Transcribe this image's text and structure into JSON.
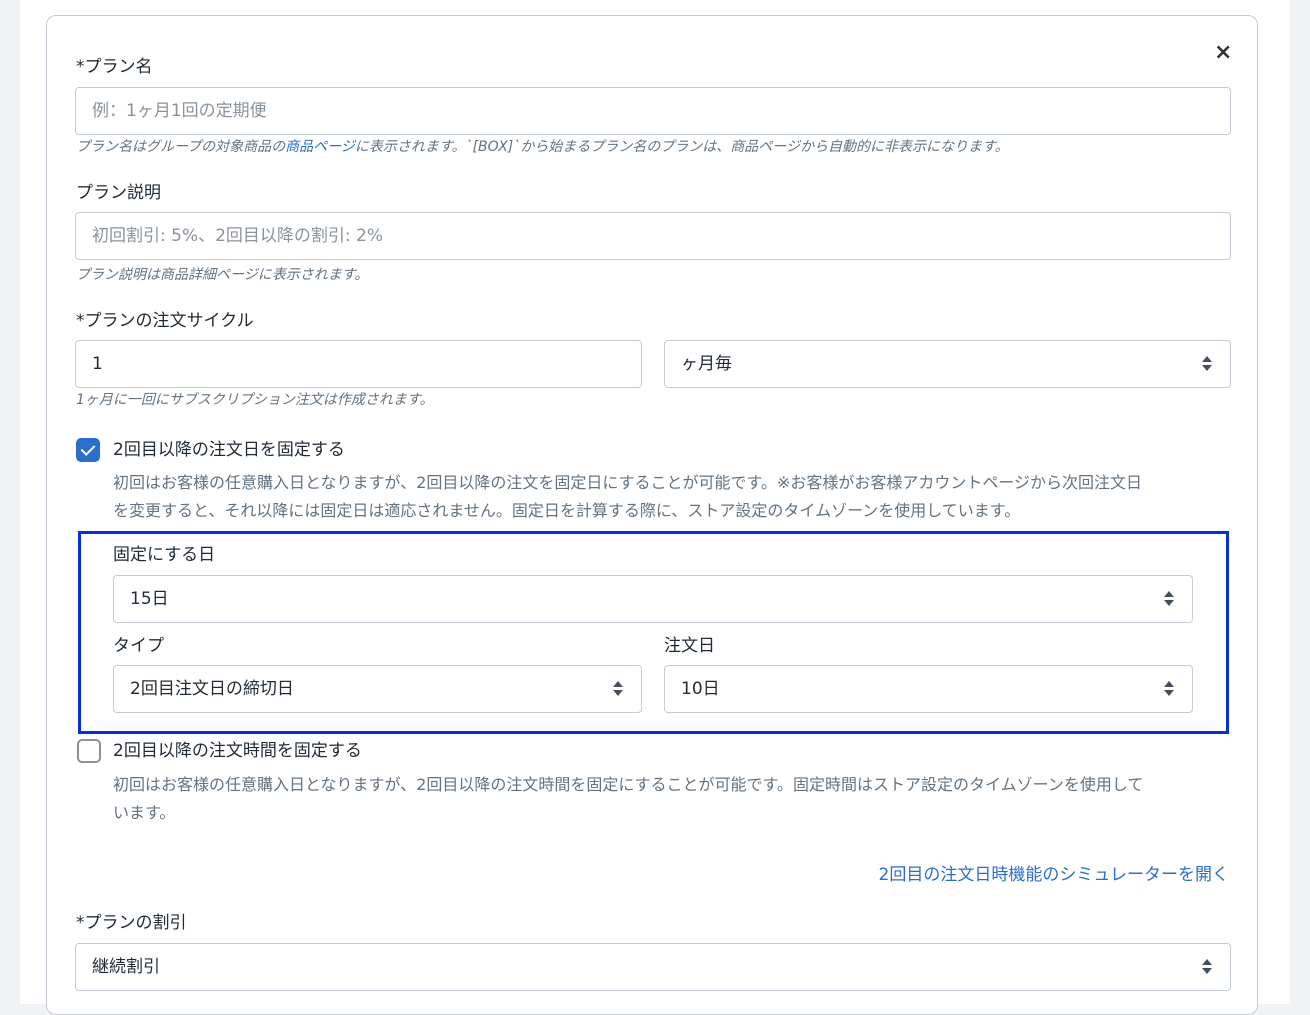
{
  "close_icon": "×",
  "plan_name": {
    "label": "*プラン名",
    "placeholder": "例：1ヶ月1回の定期便",
    "help_before": "プラン名はグループの対象商品の",
    "help_link": "商品ページ",
    "help_after": "に表示されます。`[BOX]`から始まるプラン名のプランは、商品ページから自動的に非表示になります。"
  },
  "plan_description": {
    "label": "プラン説明",
    "placeholder": "初回割引: 5%、2回目以降の割引: 2%",
    "help": "プラン説明は商品詳細ページに表示されます。"
  },
  "order_cycle": {
    "label": "*プランの注文サイクル",
    "value": "1",
    "unit": "ヶ月毎",
    "help": "1ヶ月に一回にサブスクリプション注文は作成されます。"
  },
  "fix_date": {
    "checked": true,
    "label": "2回目以降の注文日を固定する",
    "desc_line1": "初回はお客様の任意購入日となりますが、2回目以降の注文を固定日にすることが可能です。※お客様がお客様アカウントページから次回注文日",
    "desc_line2": "を変更すると、それ以降には固定日は適応されません。固定日を計算する際に、ストア設定のタイムゾーンを使用しています。",
    "fixed_day_label": "固定にする日",
    "fixed_day_value": "15日",
    "type_label": "タイプ",
    "type_value": "2回目注文日の締切日",
    "order_day_label": "注文日",
    "order_day_value": "10日"
  },
  "fix_time": {
    "checked": false,
    "label": "2回目以降の注文時間を固定する",
    "desc_line1": "初回はお客様の任意購入日となりますが、2回目以降の注文時間を固定にすることが可能です。固定時間はストア設定のタイムゾーンを使用して",
    "desc_line2": "います。"
  },
  "simulator_link": "2回目の注文日時機能のシミュレーターを開く",
  "discount": {
    "label": "*プランの割引",
    "value": "継続割引"
  }
}
